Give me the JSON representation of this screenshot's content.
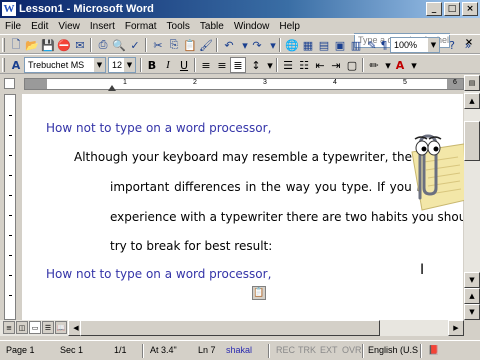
{
  "window": {
    "title": "Lesson1 - Microsoft Word",
    "app_icon": "W"
  },
  "menu": [
    "File",
    "Edit",
    "View",
    "Insert",
    "Format",
    "Tools",
    "Table",
    "Window",
    "Help"
  ],
  "help_box": {
    "placeholder": "Type a question for help"
  },
  "toolbar_standard": {
    "zoom": "100%"
  },
  "toolbar_formatting": {
    "style": "A",
    "font": "Trebuchet MS",
    "size": "12",
    "bold": "B",
    "italic": "I",
    "underline": "U"
  },
  "document": {
    "heading": "How not to type on a word processor,",
    "paragraph_lines": [
      "Although your keyboard may resemble a typewriter, there are",
      "important differences in the way you type. If you have",
      "experience with a typewriter there are two habits you should",
      "try to break for best result:"
    ],
    "heading_repeat": "How not to type on a word processor,"
  },
  "ruler": {
    "numbers": [
      "1",
      "2",
      "3",
      "4",
      "5",
      "6"
    ]
  },
  "status": {
    "page": "Page 1",
    "section": "Sec 1",
    "page_of": "1/1",
    "at": "At 3.4\"",
    "line": "Ln 7",
    "user": "shakal",
    "rec": "REC",
    "trk": "TRK",
    "ext": "EXT",
    "ovr": "OVR",
    "language": "English (U.S"
  },
  "colors": {
    "heading": "#3434a8",
    "title_bar": "#0a246a"
  },
  "icons": [
    "new-document-icon",
    "open-icon",
    "save-icon",
    "permission-icon",
    "email-icon",
    "print-icon",
    "print-preview-icon",
    "spelling-icon",
    "cut-icon",
    "copy-icon",
    "paste-icon",
    "format-painter-icon",
    "undo-icon",
    "redo-icon",
    "hyperlink-icon",
    "tables-borders-icon",
    "insert-table-icon",
    "insert-excel-icon",
    "columns-icon",
    "drawing-icon",
    "doc-map-icon",
    "show-hide-icon",
    "help-icon",
    "office-assistant-icon"
  ]
}
